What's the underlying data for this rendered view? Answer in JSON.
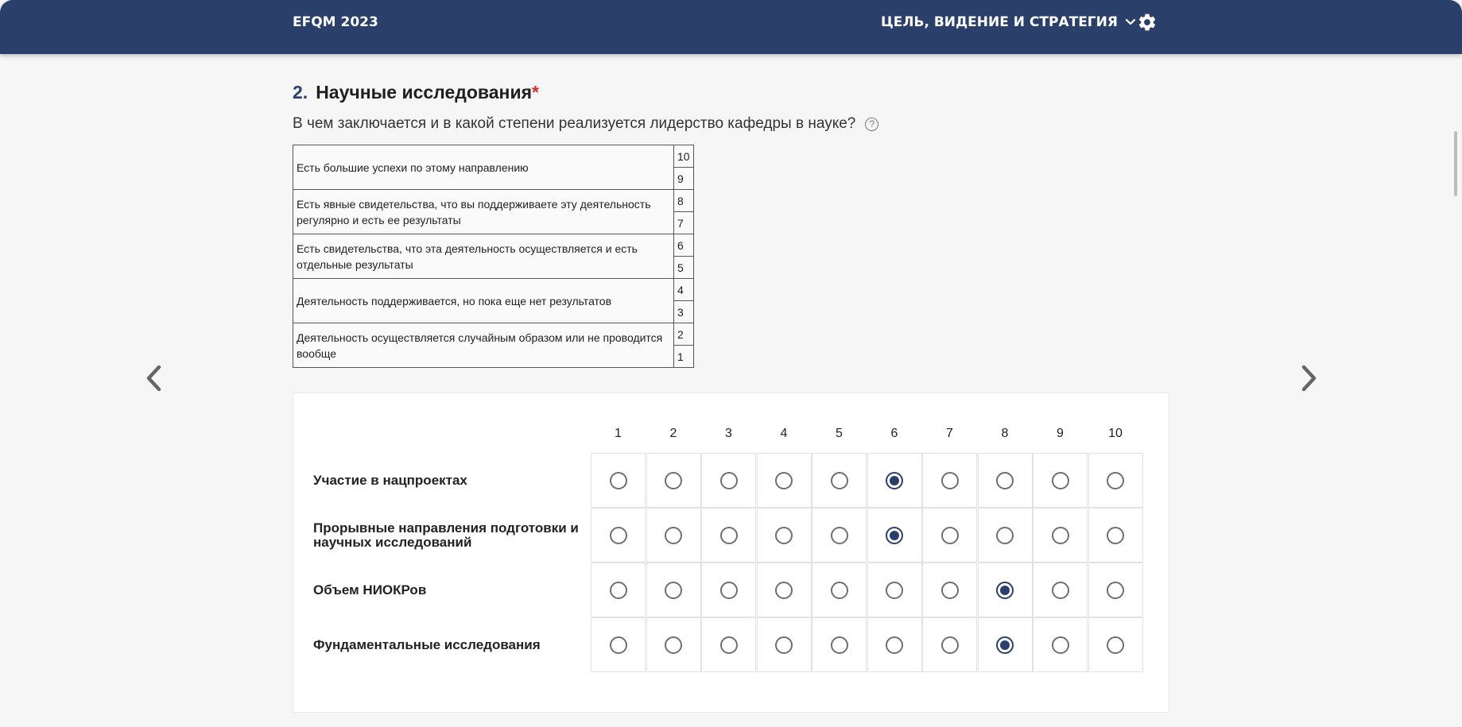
{
  "header": {
    "app_title": "EFQM 2023",
    "section_label": "ЦЕЛЬ, ВИДЕНИЕ И СТРАТЕГИЯ",
    "section_icon": "chevron-down-icon",
    "settings_icon": "gear-icon"
  },
  "question": {
    "number": "2.",
    "title": "Научные исследования",
    "required_mark": "*",
    "description": "В чем заключается и в какой степени реализуется лидерство кафедры в науке?",
    "help_symbol": "?"
  },
  "scale_table": [
    {
      "text": "Есть большие успехи по этому направлению",
      "scores": [
        "10",
        "9"
      ]
    },
    {
      "text": "Есть явные свидетельства, что вы поддерживаете эту деятельность регулярно и есть ее результаты",
      "scores": [
        "8",
        "7"
      ]
    },
    {
      "text": "Есть свидетельства, что эта деятельность осуществляется и есть отдельные результаты",
      "scores": [
        "6",
        "5"
      ]
    },
    {
      "text": "Деятельность поддерживается, но пока еще нет результатов",
      "scores": [
        "4",
        "3"
      ]
    },
    {
      "text": "Деятельность осуществляется случайным образом или не проводится вообще",
      "scores": [
        "2",
        "1"
      ]
    }
  ],
  "matrix": {
    "columns": [
      "1",
      "2",
      "3",
      "4",
      "5",
      "6",
      "7",
      "8",
      "9",
      "10"
    ],
    "rows": [
      {
        "label": "Участие в нацпроектах",
        "selected": "6"
      },
      {
        "label": "Прорывные направления подготовки и научных исследований",
        "selected": "6"
      },
      {
        "label": "Объем НИОКРов",
        "selected": "8"
      },
      {
        "label": "Фундаментальные исследования",
        "selected": "8"
      }
    ]
  },
  "nav": {
    "prev_icon": "chevron-left-icon",
    "next_icon": "chevron-right-icon"
  },
  "colors": {
    "header_bg": "#2b3f6b",
    "accent": "#2b3f6b",
    "required": "#d3302f"
  }
}
